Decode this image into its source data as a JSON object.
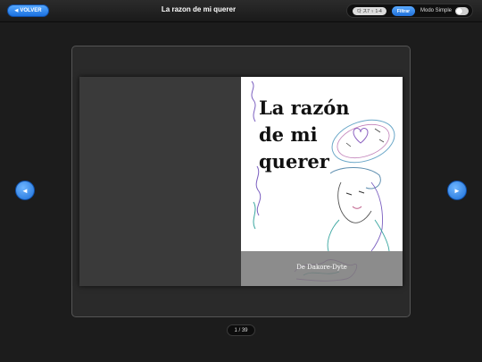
{
  "header": {
    "back_label": "VOLVER",
    "back_icon": "triangle-left-icon",
    "title": "La razon de mi querer",
    "filter_chip": "다 ス7 ♀ 1-4",
    "filter_button": "Filtrar",
    "mode_label": "Modo Simple",
    "mode_simple_on": false
  },
  "book": {
    "cover_title_line1": "La razón",
    "cover_title_line2": "de mi",
    "cover_title_line3": "querer",
    "cover_author": "De Dakore-Dyte"
  },
  "navigation": {
    "prev_icon": "◄",
    "next_icon": "►",
    "page_counter": "1 / 39"
  },
  "colors": {
    "accent": "#1c72e0",
    "background": "#1c1c1c"
  }
}
